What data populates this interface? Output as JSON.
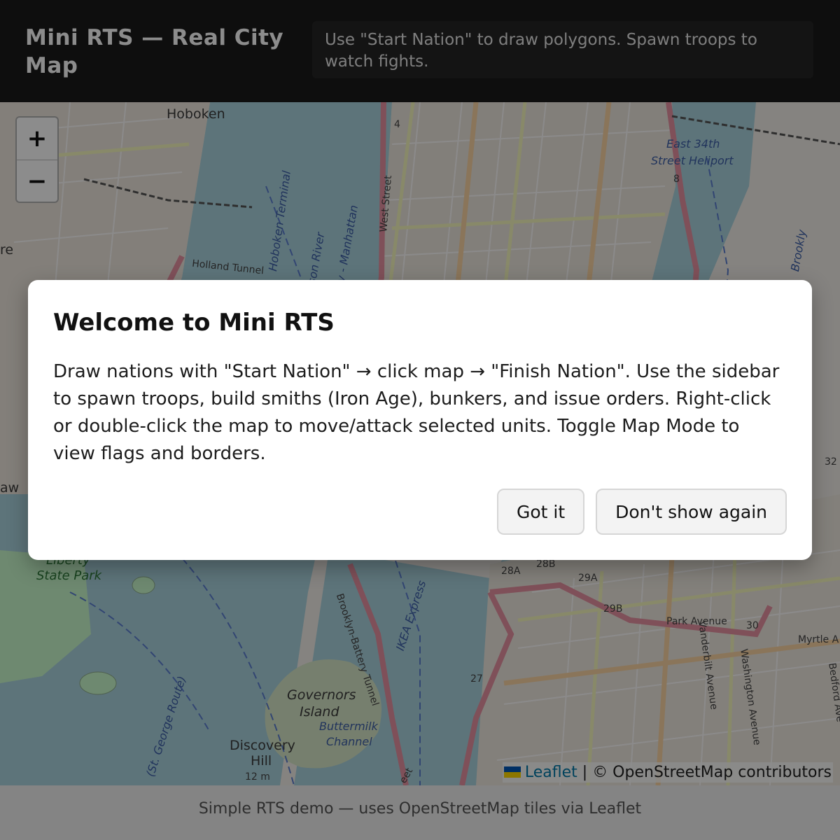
{
  "header": {
    "title": "Mini RTS — Real City Map",
    "hint": "Use \"Start Nation\" to draw polygons. Spawn troops to watch fights."
  },
  "map": {
    "zoom_in": "+",
    "zoom_out": "−",
    "labels": {
      "hoboken": "Hoboken",
      "hoboken_terminal": "Hoboken Terminal",
      "hudson_river": "Hudson River",
      "battery_park": "Battery Park City - Manhattan",
      "west_street": "West Street",
      "east_34th": "East 34th",
      "street_heliport": "Street Heliport",
      "holland_tunnel": "Holland Tunnel",
      "liberty": "Liberty",
      "state_park": "State Park",
      "governors": "Governors",
      "island": "Island",
      "buttermilk": "Buttermilk",
      "channel": "Channel",
      "discovery": "Discovery",
      "hill": "Hill",
      "elevation": "12 m",
      "brooklyn_battery": "Brooklyn-Battery Tunnel",
      "ikea": "IKEA Express",
      "park_avenue": "Park Avenue",
      "vanderbilt": "Vanderbilt Avenue",
      "washington": "Washington Avenue",
      "myrtle": "Myrtle A",
      "bedford": "Bedford Ave",
      "brooklyn": "Brookly",
      "st_george": "(St. George Route)",
      "route_4": "4",
      "route_8": "8",
      "exit_28a": "28A",
      "exit_28b": "28B",
      "exit_29a": "29A",
      "exit_29b": "29B",
      "exit_30": "30",
      "exit_27": "27",
      "exit_32": "32",
      "edge_re": "re",
      "edge_aw": "aw",
      "edge_et": "eet"
    },
    "attribution": {
      "leaflet": "Leaflet",
      "separator": "|",
      "credit": "© OpenStreetMap contributors"
    },
    "colors": {
      "water": "#aad3df",
      "land": "#f2efe9",
      "park": "#c8facc",
      "highway": "#e892a2",
      "major_road": "#fcd6a4",
      "minor_road": "#f7fabf"
    }
  },
  "footer": {
    "text": "Simple RTS demo — uses OpenStreetMap tiles via Leaflet"
  },
  "modal": {
    "title": "Welcome to Mini RTS",
    "body": "Draw nations with \"Start Nation\" → click map → \"Finish Nation\". Use the sidebar to spawn troops, build smiths (Iron Age), bunkers, and issue orders. Right-click or double-click the map to move/attack selected units. Toggle Map Mode to view flags and borders.",
    "got_it": "Got it",
    "dont_show": "Don't show again"
  }
}
